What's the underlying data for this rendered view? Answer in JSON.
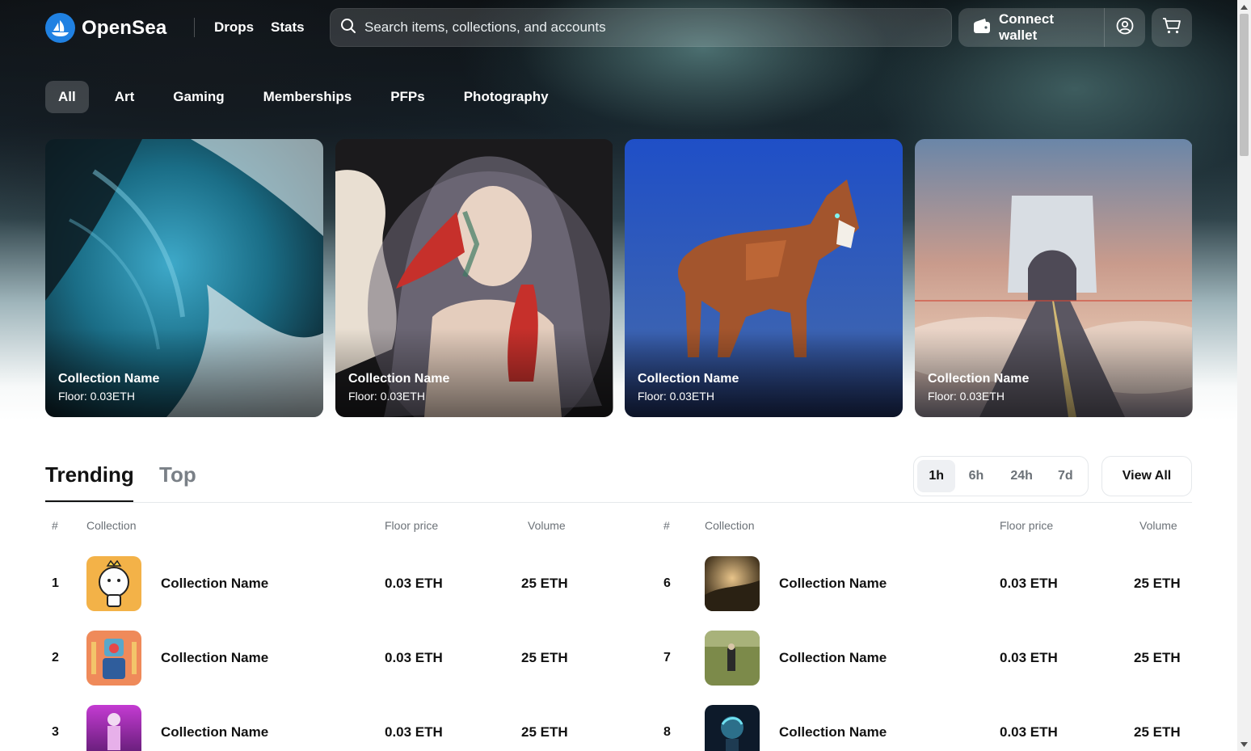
{
  "header": {
    "brand": "OpenSea",
    "nav": [
      "Drops",
      "Stats"
    ],
    "search_placeholder": "Search items, collections, and accounts",
    "connect_wallet": "Connect wallet"
  },
  "categories": [
    {
      "label": "All",
      "active": true
    },
    {
      "label": "Art",
      "active": false
    },
    {
      "label": "Gaming",
      "active": false
    },
    {
      "label": "Memberships",
      "active": false
    },
    {
      "label": "PFPs",
      "active": false
    },
    {
      "label": "Photography",
      "active": false
    }
  ],
  "featured": [
    {
      "name": "Collection Name",
      "floor": "Floor: 0.03ETH"
    },
    {
      "name": "Collection Name",
      "floor": "Floor: 0.03ETH"
    },
    {
      "name": "Collection Name",
      "floor": "Floor: 0.03ETH"
    },
    {
      "name": "Collection Name",
      "floor": "Floor: 0.03ETH"
    }
  ],
  "ranking": {
    "tabs": [
      "Trending",
      "Top"
    ],
    "active_tab": "Trending",
    "time_options": [
      "1h",
      "6h",
      "24h",
      "7d"
    ],
    "active_time": "1h",
    "view_all": "View All",
    "columns": [
      "#",
      "Collection",
      "Floor price",
      "Volume"
    ],
    "left_rows": [
      {
        "rank": "1",
        "name": "Collection Name",
        "floor": "0.03 ETH",
        "volume": "25 ETH"
      },
      {
        "rank": "2",
        "name": "Collection Name",
        "floor": "0.03 ETH",
        "volume": "25 ETH"
      },
      {
        "rank": "3",
        "name": "Collection Name",
        "floor": "0.03 ETH",
        "volume": "25 ETH"
      }
    ],
    "right_rows": [
      {
        "rank": "6",
        "name": "Collection Name",
        "floor": "0.03 ETH",
        "volume": "25 ETH"
      },
      {
        "rank": "7",
        "name": "Collection Name",
        "floor": "0.03 ETH",
        "volume": "25 ETH"
      },
      {
        "rank": "8",
        "name": "Collection Name",
        "floor": "0.03 ETH",
        "volume": "25 ETH"
      }
    ]
  },
  "colors": {
    "brand_blue": "#2081e2",
    "text": "#121212",
    "muted": "#6b7177",
    "border": "#e5e8eb"
  }
}
